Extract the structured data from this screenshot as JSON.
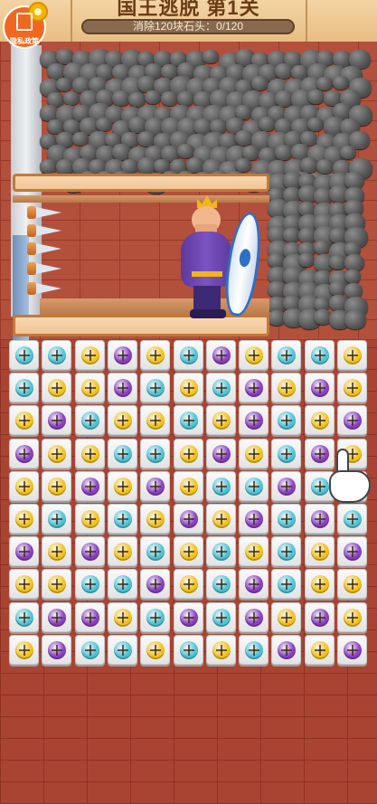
{
  "header": {
    "title": "国王逃脱 第1关",
    "progress_text": "消除120块石头：0/120",
    "privacy_badge_label": "隐私政策"
  },
  "colors": {
    "cyan_screw": "#4ec3d6",
    "yellow_screw": "#f2c21b",
    "purple_screw": "#8a3fc2",
    "tile_face": "#f2f2f2"
  },
  "grid": {
    "rows": [
      [
        "c",
        "c",
        "y",
        "p",
        "y",
        "c",
        "p",
        "y",
        "c",
        "c",
        "y"
      ],
      [
        "c",
        "y",
        "y",
        "p",
        "c",
        "y",
        "c",
        "p",
        "y",
        "p",
        "y"
      ],
      [
        "y",
        "p",
        "c",
        "y",
        "y",
        "c",
        "y",
        "p",
        "c",
        "y",
        "p"
      ],
      [
        "p",
        "y",
        "y",
        "c",
        "c",
        "y",
        "p",
        "y",
        "c",
        "p",
        "y"
      ],
      [
        "y",
        "y",
        "p",
        "y",
        "p",
        "y",
        "c",
        "c",
        "p",
        "c",
        "y"
      ],
      [
        "y",
        "c",
        "y",
        "c",
        "y",
        "p",
        "y",
        "p",
        "c",
        "p",
        "c"
      ],
      [
        "p",
        "y",
        "p",
        "y",
        "c",
        "y",
        "c",
        "y",
        "c",
        "y",
        "p"
      ],
      [
        "y",
        "y",
        "c",
        "c",
        "p",
        "y",
        "c",
        "p",
        "c",
        "y",
        "y"
      ],
      [
        "c",
        "p",
        "p",
        "y",
        "c",
        "p",
        "c",
        "p",
        "y",
        "p",
        "y"
      ],
      [
        "y",
        "p",
        "c",
        "c",
        "y",
        "c",
        "y",
        "c",
        "p",
        "y",
        "p"
      ]
    ]
  },
  "icons": {
    "privacy": "privacy-doc-icon",
    "settings": "gear-icon",
    "pointer": "hand-pointer-icon"
  }
}
